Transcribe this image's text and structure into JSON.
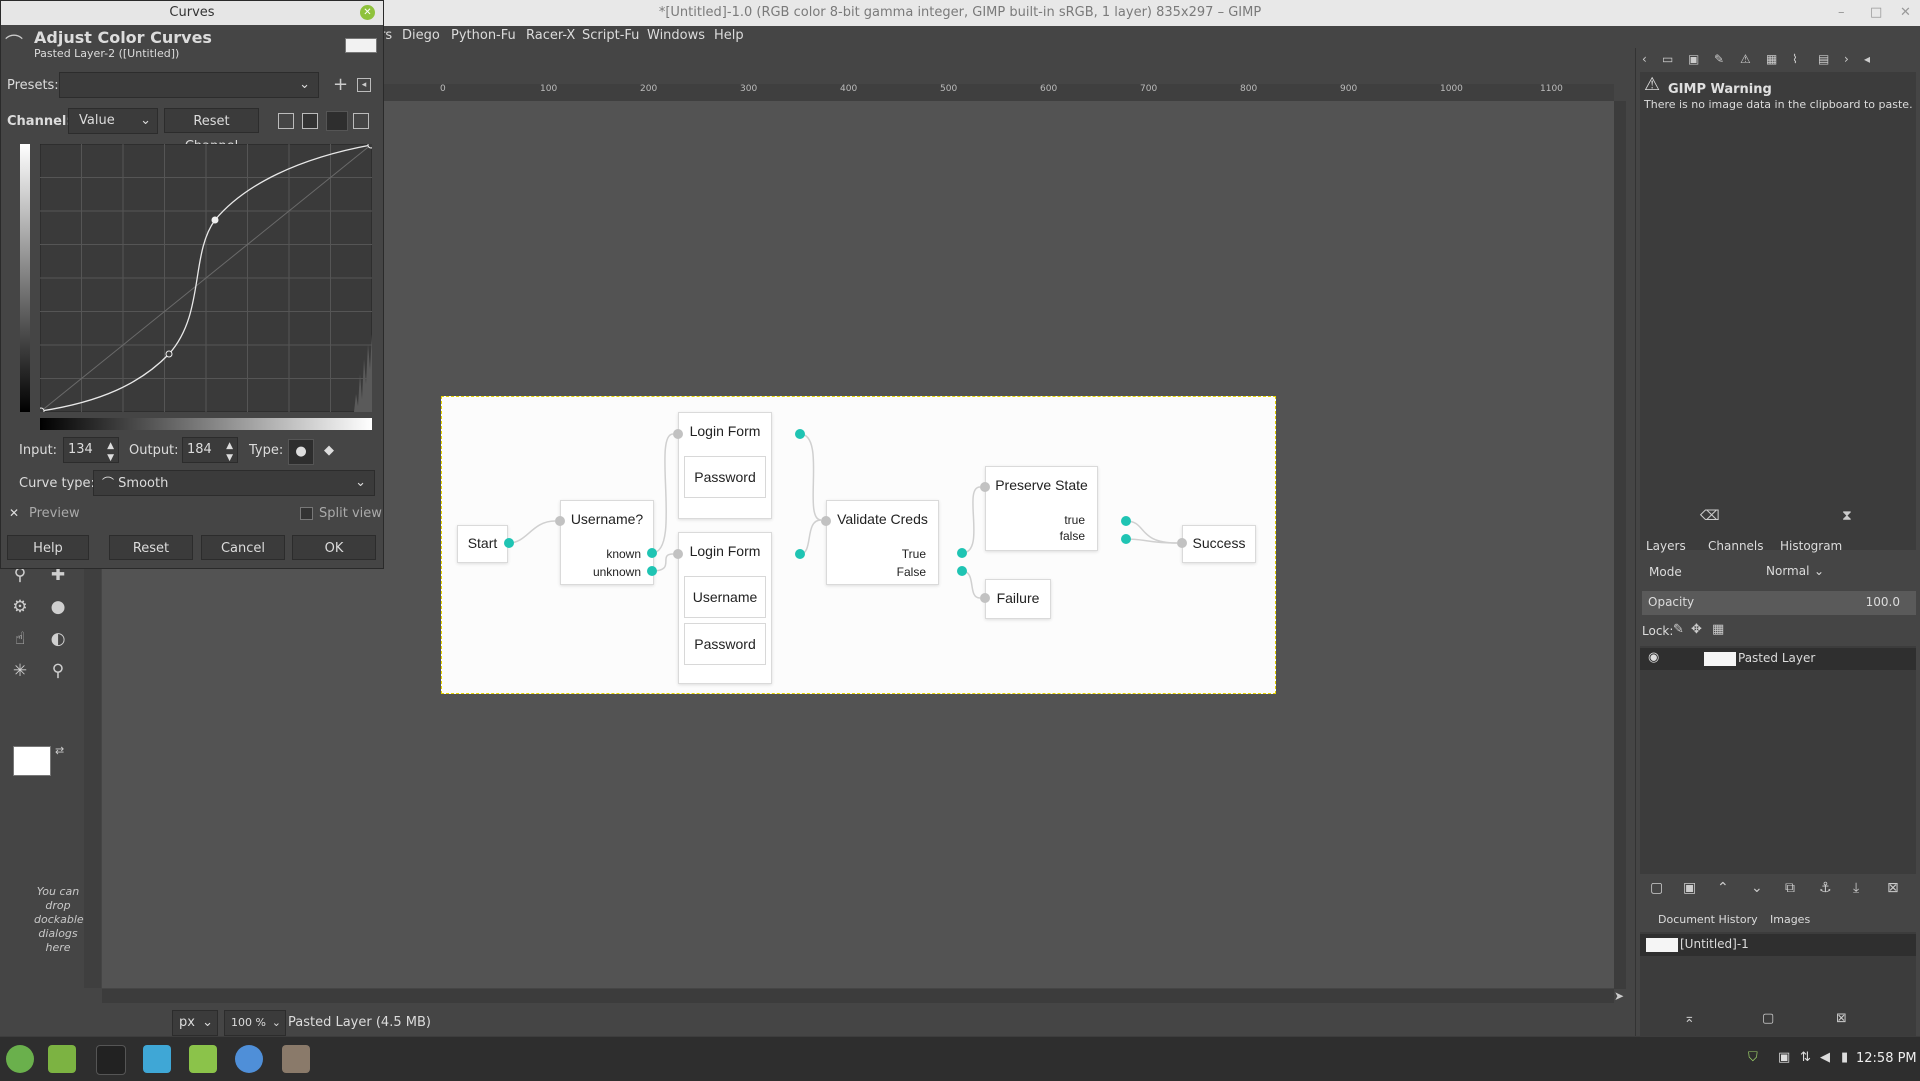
{
  "window": {
    "title": "*[Untitled]-1.0 (RGB color 8-bit gamma integer, GIMP built-in sRGB, 1 layer) 835x297 – GIMP"
  },
  "menu": [
    "rs",
    "Diego",
    "Python-Fu",
    "Racer-X",
    "Script-Fu",
    "Windows",
    "Help"
  ],
  "rulers": {
    "h_ticks": [
      "0",
      "100",
      "200",
      "300",
      "400",
      "500",
      "600",
      "700",
      "800",
      "900",
      "1000",
      "1100"
    ]
  },
  "toolbox": {
    "drop_note": "You can drop dockable dialogs here"
  },
  "curves_dialog": {
    "window_title": "Curves",
    "heading": "Adjust Color Curves",
    "subheading": "Pasted Layer-2 ([Untitled])",
    "presets_label": "Presets:",
    "presets_value": "",
    "channel_label": "Channel:",
    "channel_value": "Value",
    "reset_channel": "Reset Channel",
    "input_label": "Input:",
    "input_value": "134",
    "output_label": "Output:",
    "output_value": "184",
    "type_label": "Type:",
    "curve_type_label": "Curve type:",
    "curve_type_value": "Smooth",
    "preview_label": "Preview",
    "preview_checked": true,
    "split_view_label": "Split view",
    "split_view_checked": false,
    "buttons": {
      "help": "Help",
      "reset": "Reset",
      "cancel": "Cancel",
      "ok": "OK"
    }
  },
  "image_nodes": {
    "start": "Start",
    "username_q": {
      "title": "Username?",
      "out1": "known",
      "out2": "unknown"
    },
    "login_form_top": {
      "title": "Login Form",
      "field1": "Password"
    },
    "login_form_bottom": {
      "title": "Login Form",
      "field1": "Username",
      "field2": "Password"
    },
    "validate": {
      "title": "Validate Creds",
      "out1": "True",
      "out2": "False"
    },
    "preserve": {
      "title": "Preserve State",
      "out1": "true",
      "out2": "false"
    },
    "success": "Success",
    "failure": "Failure"
  },
  "status": {
    "unit": "px",
    "zoom": "100 %",
    "message": "Pasted Layer (4.5 MB)"
  },
  "dock": {
    "warning_title": "GIMP Warning",
    "warning_text": "There is no image data in the clipboard to paste.",
    "tabs": [
      "Layers",
      "Channels",
      "Histogram"
    ],
    "mode_label": "Mode",
    "mode_value": "Normal",
    "opacity_label": "Opacity",
    "opacity_value": "100.0",
    "lock_label": "Lock:",
    "layer_name": "Pasted Layer",
    "bottom_tabs": [
      "Document History",
      "Images"
    ],
    "image_item": "[Untitled]-1"
  },
  "taskbar": {
    "clock": "12:58 PM"
  }
}
